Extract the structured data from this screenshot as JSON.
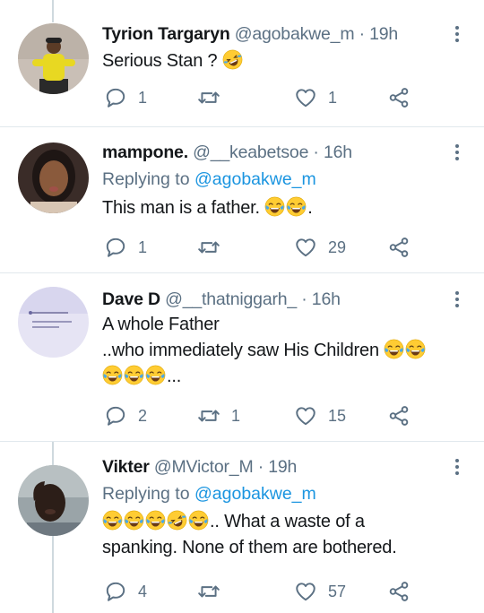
{
  "tweets": [
    {
      "name": "Tyrion Targaryn",
      "handle": "@agobakwe_m",
      "time": "19h",
      "replying_prefix": "",
      "replying_to": "",
      "lines": [
        {
          "pre": "Serious Stan ? ",
          "emojis": [
            "rofl"
          ],
          "post": ""
        }
      ],
      "replies": "1",
      "retweets": "",
      "likes": "1"
    },
    {
      "name": "mampone.",
      "handle": "@__keabetsoe",
      "time": "16h",
      "replying_prefix": "Replying to ",
      "replying_to": "@agobakwe_m",
      "lines": [
        {
          "pre": "This man is a father. ",
          "emojis": [
            "joy",
            "joy"
          ],
          "post": "."
        }
      ],
      "replies": "1",
      "retweets": "",
      "likes": "29"
    },
    {
      "name": "Dave D",
      "handle": "@__thatniggarh_",
      "time": "16h",
      "replying_prefix": "",
      "replying_to": "",
      "lines": [
        {
          "pre": "A whole Father",
          "emojis": [],
          "post": ""
        },
        {
          "pre": "..who immediately saw His Children ",
          "emojis": [
            "joy",
            "joy"
          ],
          "post": ""
        },
        {
          "pre": "",
          "emojis": [
            "joy",
            "joy",
            "joy"
          ],
          "post": "..."
        }
      ],
      "replies": "2",
      "retweets": "1",
      "likes": "15"
    },
    {
      "name": "Vikter",
      "handle": "@MVictor_M",
      "time": "19h",
      "replying_prefix": "Replying to ",
      "replying_to": "@agobakwe_m",
      "lines": [
        {
          "pre": "",
          "emojis": [
            "joy",
            "joy",
            "joy",
            "rofl",
            "joy"
          ],
          "post": ".. What a waste of a"
        },
        {
          "pre": "spanking. None of them are bothered.",
          "emojis": [],
          "post": ""
        }
      ],
      "replies": "4",
      "retweets": "",
      "likes": "57"
    }
  ],
  "colors": {
    "text": "#14171a",
    "secondary": "#5b7083",
    "link": "#1b95e0",
    "divider": "#e1e8ed",
    "thread_line": "#cfd9de"
  },
  "icons": {
    "reply": "speech-bubble-icon",
    "retweet": "retweet-arrows-icon",
    "like": "heart-outline-icon",
    "share": "share-nodes-icon",
    "more": "vertical-dots-icon"
  }
}
